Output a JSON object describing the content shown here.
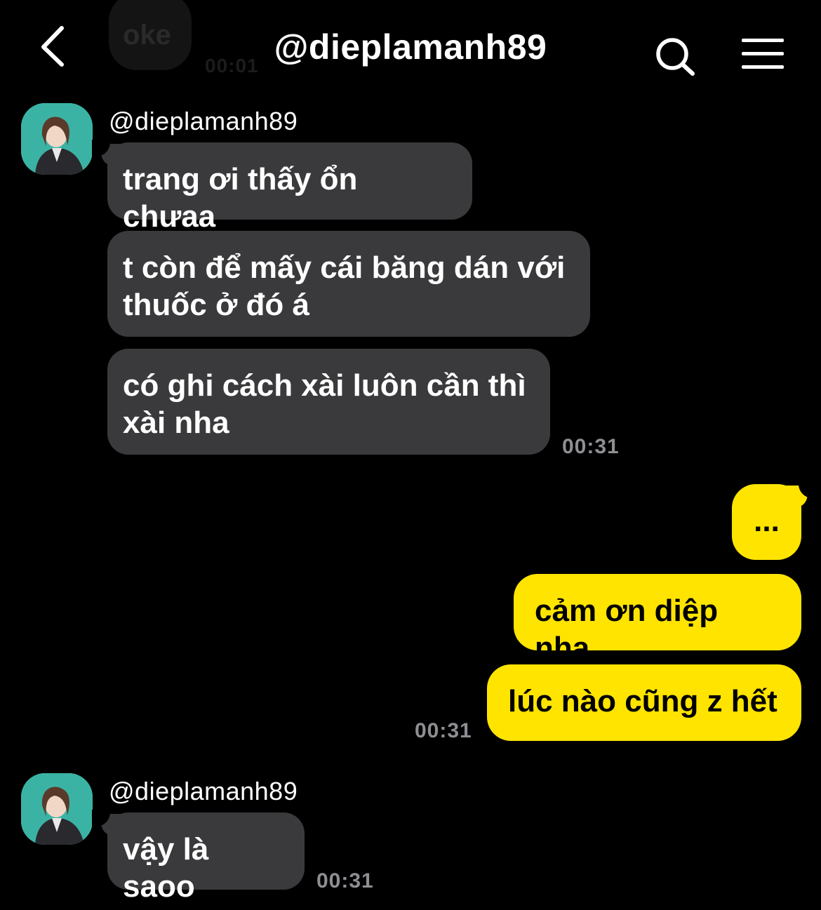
{
  "previous": {
    "text": "oke",
    "time": "00:01"
  },
  "header": {
    "title": "@dieplamanh89",
    "back_icon": "chevron-left-icon",
    "search_icon": "search-icon",
    "menu_icon": "hamburger-menu-icon"
  },
  "colors": {
    "background": "#000000",
    "incoming_bubble": "#3a3a3c",
    "outgoing_bubble": "#ffe400",
    "timestamp": "#8e8e93",
    "avatar_bg": "#3bb3a4"
  },
  "groups": [
    {
      "sender": "@dieplamanh89",
      "messages": [
        "trang ơi thấy ổn chưaa",
        "t còn để mấy cái băng dán với thuốc ở đó á",
        "có ghi cách xài luôn cần thì xài nha"
      ],
      "time": "00:31"
    },
    {
      "sender": "me",
      "messages": [
        "...",
        "cảm ơn diệp nha",
        "lúc nào cũng z hết"
      ],
      "time": "00:31"
    },
    {
      "sender": "@dieplamanh89",
      "messages": [
        "vậy là saoo"
      ],
      "time": "00:31"
    }
  ]
}
